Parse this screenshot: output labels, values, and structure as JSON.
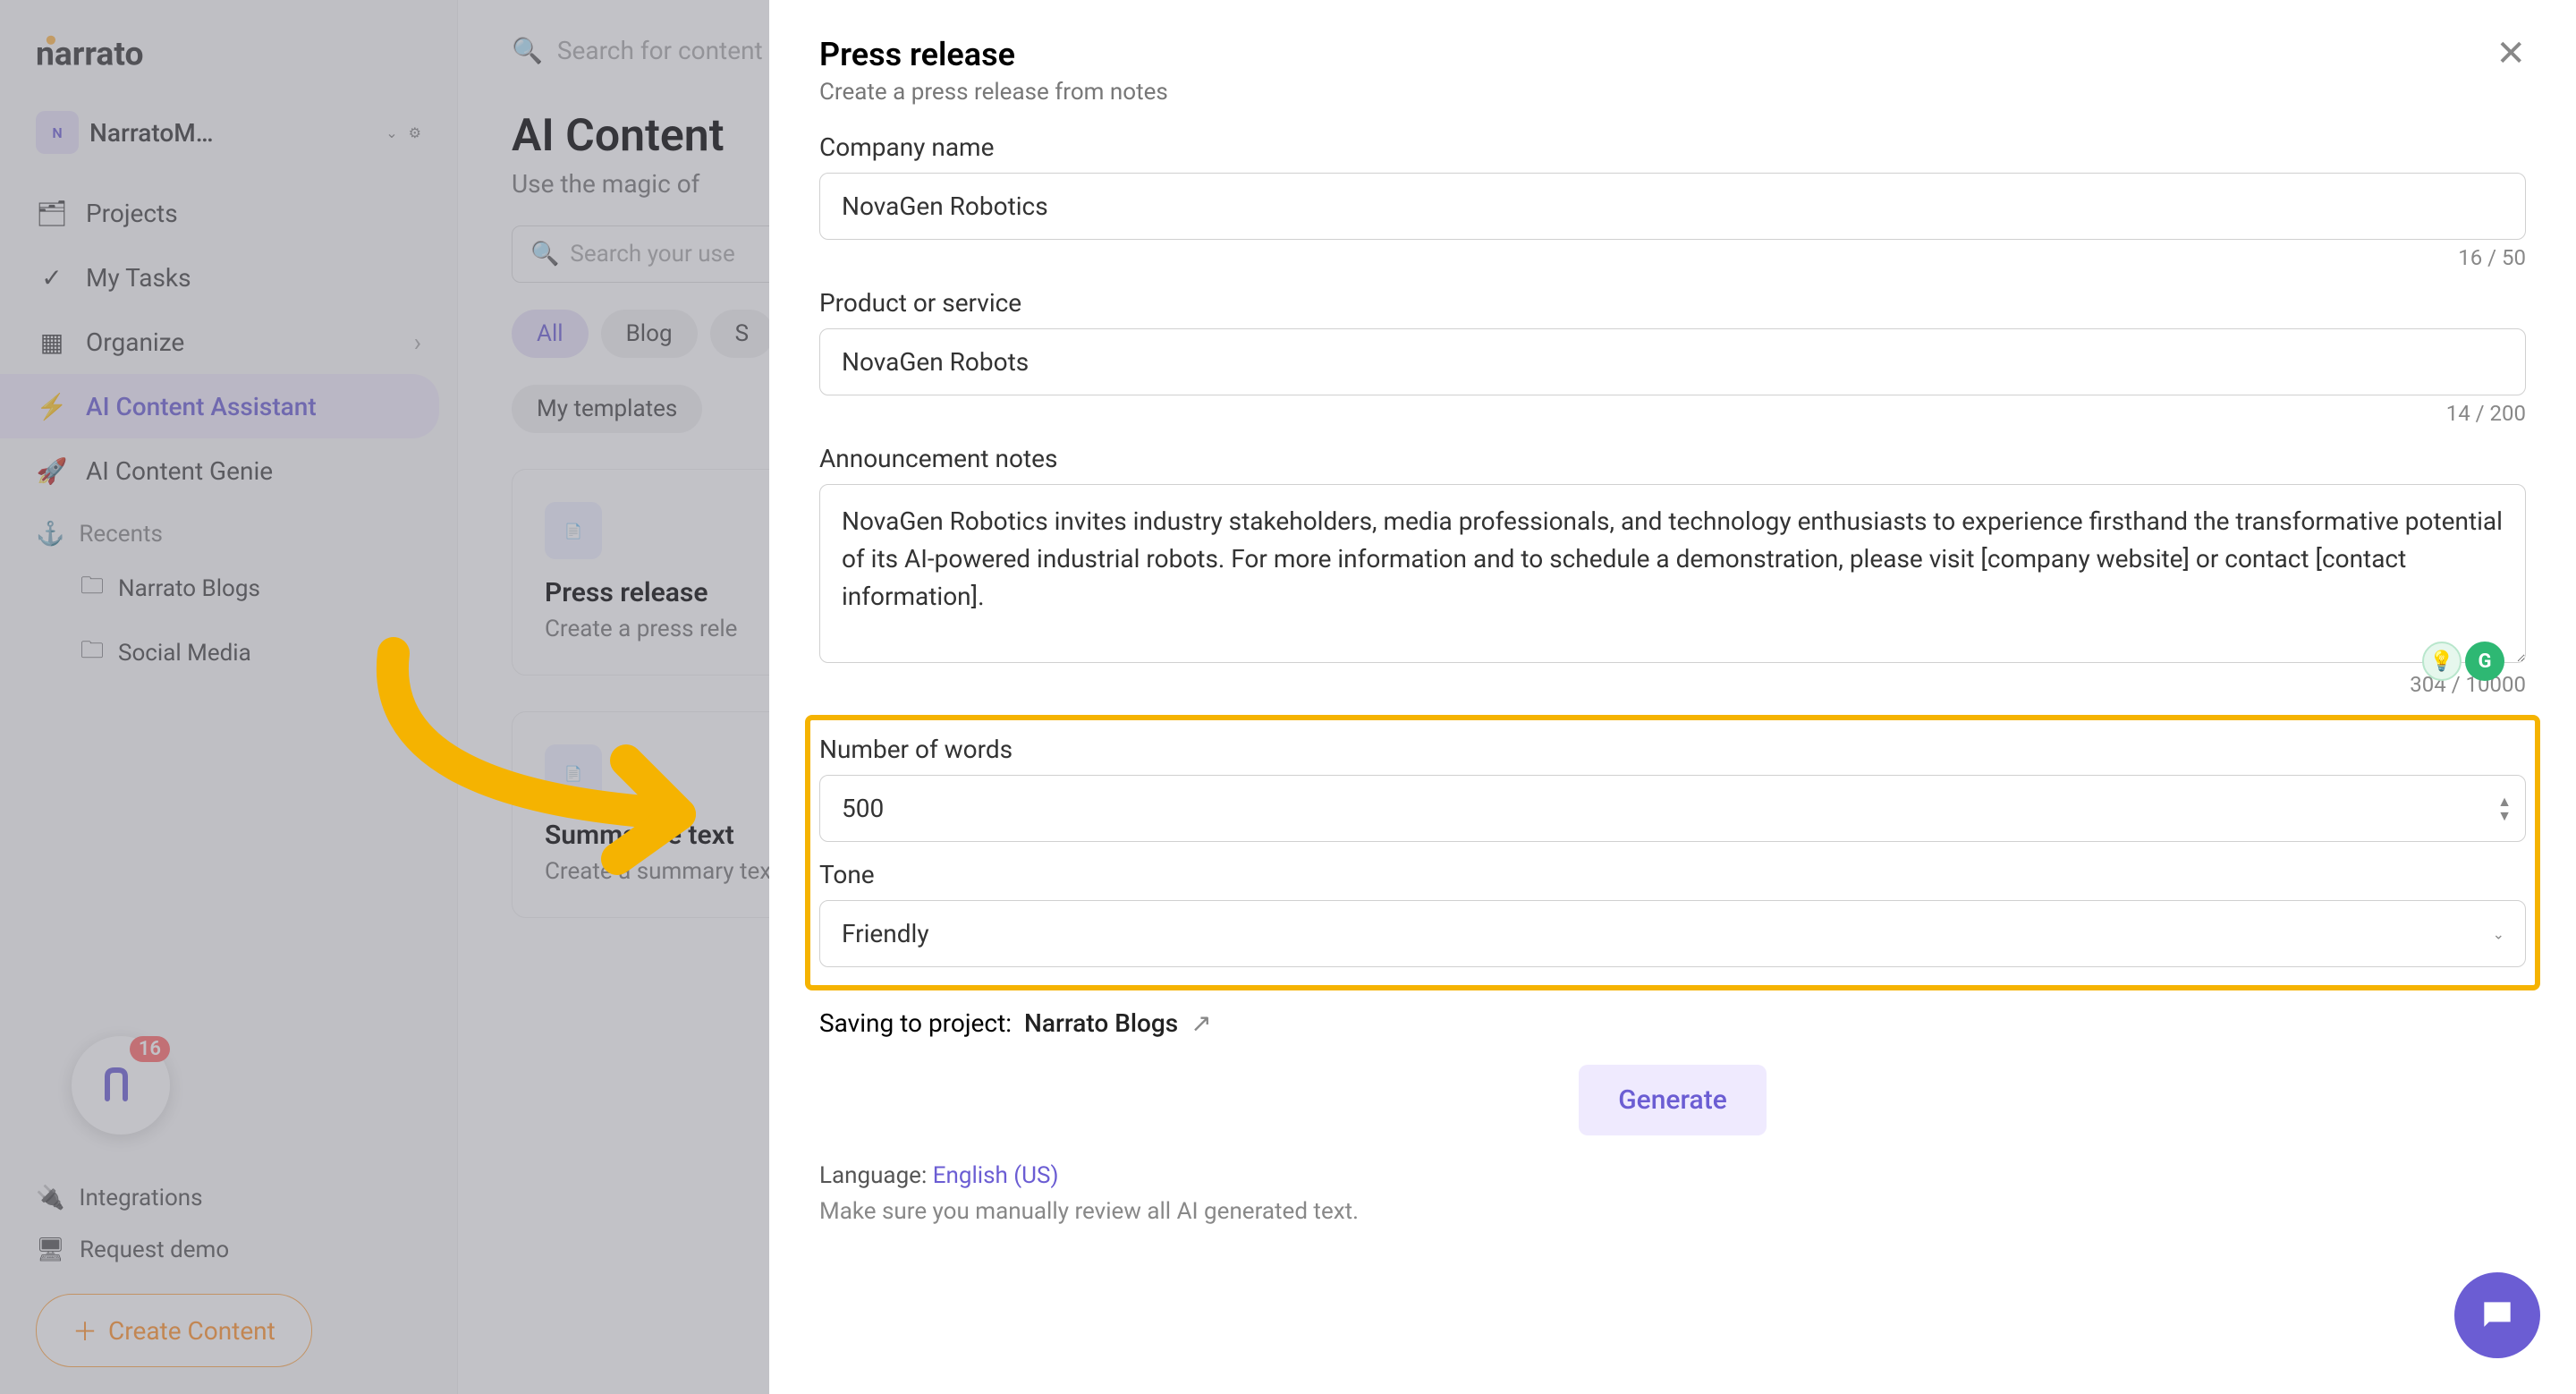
{
  "sidebar": {
    "workspace_initial": "N",
    "workspace_name": "NarratoM…",
    "nav": {
      "projects": "Projects",
      "my_tasks": "My Tasks",
      "organize": "Organize",
      "ai_assistant": "AI Content Assistant",
      "ai_genie": "AI Content Genie"
    },
    "recents_label": "Recents",
    "recents": [
      {
        "label": "Narrato Blogs"
      },
      {
        "label": "Social Media"
      }
    ],
    "integrations": "Integrations",
    "request_demo": "Request demo",
    "create_content": "Create Content",
    "notif_count": "16"
  },
  "main": {
    "search_placeholder": "Search for content",
    "title": "AI Content",
    "subtitle": "Use the magic of",
    "usecase_placeholder": "Search your use",
    "chips": [
      "All",
      "Blog",
      "S"
    ],
    "my_templates": "My templates",
    "cards": [
      {
        "title": "Press release",
        "desc": "Create a press rele"
      },
      {
        "title": "Summarize text",
        "desc": "Create a summary text"
      }
    ]
  },
  "modal": {
    "title": "Press release",
    "subtitle": "Create a press release from notes",
    "company_label": "Company name",
    "company_value": "NovaGen Robotics",
    "company_counter": "16 / 50",
    "product_label": "Product or service",
    "product_value": "NovaGen Robots",
    "product_counter": "14 / 200",
    "notes_label": "Announcement notes",
    "notes_value": "NovaGen Robotics invites industry stakeholders, media professionals, and technology enthusiasts to experience firsthand the transformative potential of its AI-powered industrial robots. For more information and to schedule a demonstration, please visit [company website] or contact [contact information].",
    "notes_counter": "304 / 10000",
    "words_label": "Number of words",
    "words_value": "500",
    "tone_label": "Tone",
    "tone_value": "Friendly",
    "saving_label": "Saving to project:",
    "saving_project": "Narrato Blogs",
    "generate": "Generate",
    "language_label": "Language:",
    "language_value": "English (US)",
    "disclaimer": "Make sure you manually review all AI generated text."
  }
}
